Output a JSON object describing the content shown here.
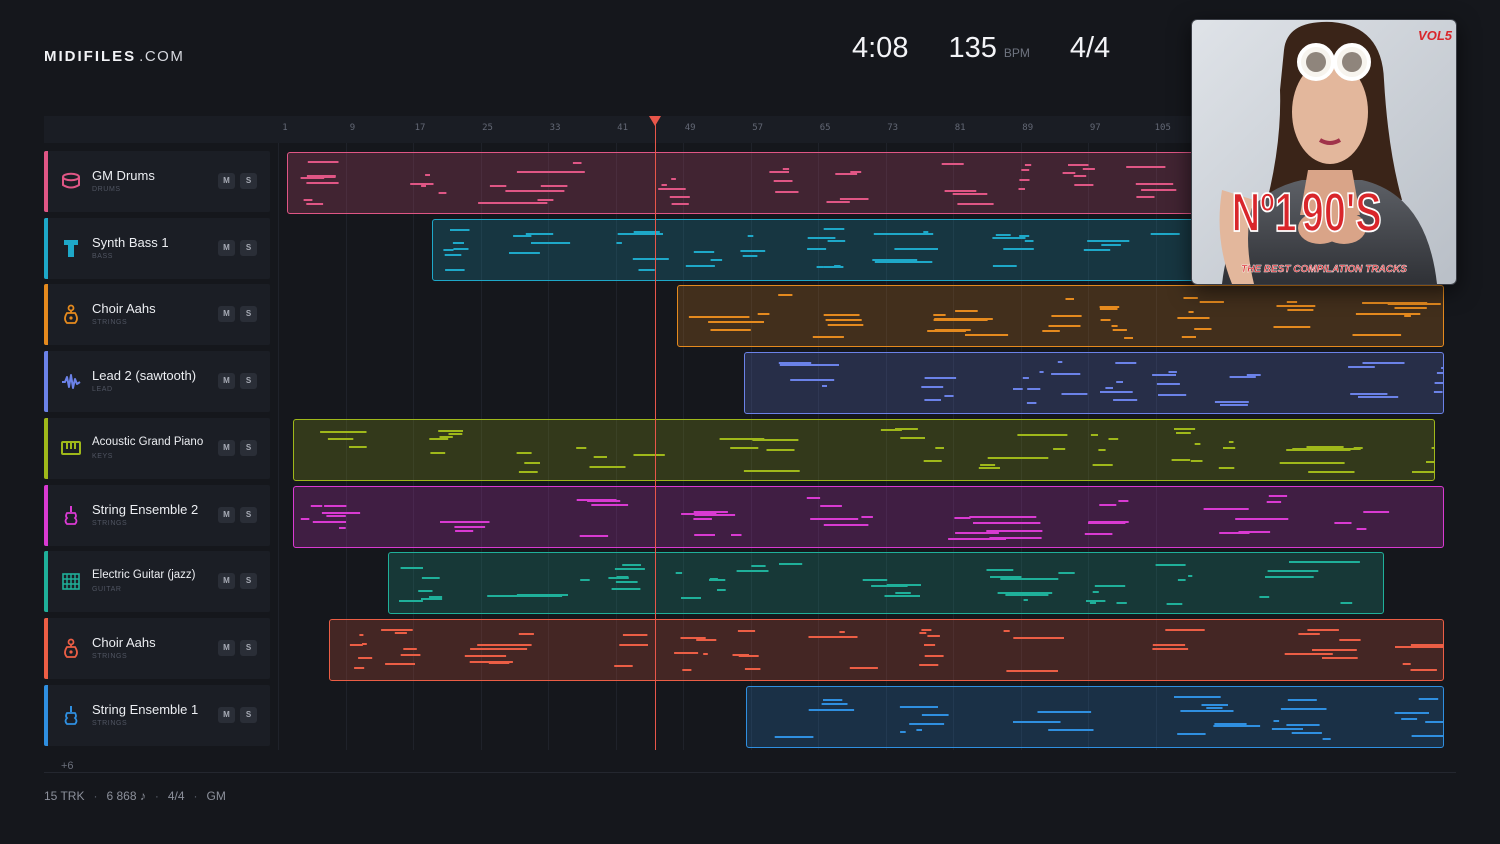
{
  "brand": {
    "name": "MIDIFILES",
    "domain": ".COM"
  },
  "transport": {
    "time": "4:08",
    "bpm": "135",
    "bpm_unit": "BPM",
    "signature": "4/4"
  },
  "ruler": {
    "bars": [
      "1",
      "9",
      "17",
      "25",
      "33",
      "41",
      "49",
      "57",
      "65",
      "73",
      "81",
      "89",
      "97",
      "105"
    ]
  },
  "playhead": {
    "bar": 46.5
  },
  "tracks": [
    {
      "name": "GM Drums",
      "category": "DRUMS",
      "color": "#e05685",
      "icon": "drum-icon",
      "mute": "M",
      "solo": "S",
      "clip_start_bar": 1.2,
      "clip_end_bar": 112
    },
    {
      "name": "Synth Bass 1",
      "category": "BASS",
      "color": "#1ea8c8",
      "icon": "bass-icon",
      "mute": "M",
      "solo": "S",
      "clip_start_bar": 18.4,
      "clip_end_bar": 112
    },
    {
      "name": "Choir Aahs",
      "category": "STRINGS",
      "color": "#e58a1e",
      "icon": "choir-icon",
      "mute": "M",
      "solo": "S",
      "clip_start_bar": 47.5,
      "clip_end_bar": 138.8
    },
    {
      "name": "Lead 2 (sawtooth)",
      "category": "LEAD",
      "color": "#6b82e8",
      "icon": "wave-icon",
      "mute": "M",
      "solo": "S",
      "clip_start_bar": 55.4,
      "clip_end_bar": 138.8
    },
    {
      "name": "Acoustic Grand Piano",
      "category": "KEYS",
      "color": "#9fb81a",
      "icon": "piano-icon",
      "mute": "M",
      "solo": "S",
      "clip_start_bar": 1.9,
      "clip_end_bar": 137
    },
    {
      "name": "String Ensemble 2",
      "category": "STRINGS",
      "color": "#d93ad2",
      "icon": "violin-icon",
      "mute": "M",
      "solo": "S",
      "clip_start_bar": 2,
      "clip_end_bar": 138.8
    },
    {
      "name": "Electric Guitar (jazz)",
      "category": "GUITAR",
      "color": "#1fb09a",
      "icon": "guitar-icon",
      "mute": "M",
      "solo": "S",
      "clip_start_bar": 13.2,
      "clip_end_bar": 131
    },
    {
      "name": "Choir Aahs",
      "category": "STRINGS",
      "color": "#ec5e45",
      "icon": "choir-icon",
      "mute": "M",
      "solo": "S",
      "clip_start_bar": 6.2,
      "clip_end_bar": 138.8
    },
    {
      "name": "String Ensemble 1",
      "category": "STRINGS",
      "color": "#2f8fe0",
      "icon": "violin-icon",
      "mute": "M",
      "solo": "S",
      "clip_start_bar": 55.6,
      "clip_end_bar": 138.8
    }
  ],
  "more_tracks": "+6",
  "footer": {
    "tracks": "15 TRK",
    "notes": "6 868 ♪",
    "signature": "4/4",
    "standard": "GM"
  },
  "cover": {
    "vol": "VOL5",
    "title_no": "Nº1",
    "title_main": "90'S",
    "tagline": "THE BEST COMPILATION TRACKS"
  }
}
